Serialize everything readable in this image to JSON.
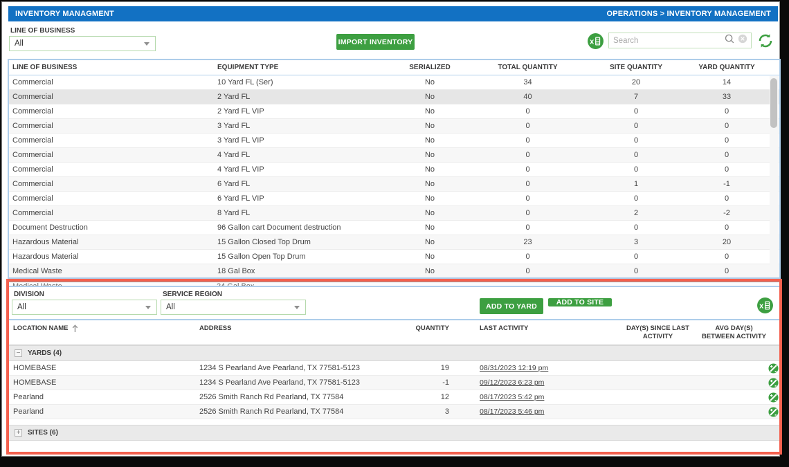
{
  "header": {
    "title": "INVENTORY MANAGMENT",
    "breadcrumb": "OPERATIONS > INVENTORY MANAGEMENT"
  },
  "toolbar": {
    "line_of_business_label": "LINE OF BUSINESS",
    "line_of_business_value": "All",
    "import_button": "IMPORT INVENTORY",
    "search_placeholder": "Search"
  },
  "inventory_table": {
    "columns": [
      "LINE OF BUSINESS",
      "EQUIPMENT TYPE",
      "SERIALIZED",
      "TOTAL QUANTITY",
      "SITE QUANTITY",
      "YARD QUANTITY"
    ],
    "selected_row_index": 1,
    "rows": [
      [
        "Commercial",
        "10 Yard FL (Ser)",
        "No",
        "34",
        "20",
        "14"
      ],
      [
        "Commercial",
        "2 Yard FL",
        "No",
        "40",
        "7",
        "33"
      ],
      [
        "Commercial",
        "2 Yard FL VIP",
        "No",
        "0",
        "0",
        "0"
      ],
      [
        "Commercial",
        "3 Yard FL",
        "No",
        "0",
        "0",
        "0"
      ],
      [
        "Commercial",
        "3 Yard FL VIP",
        "No",
        "0",
        "0",
        "0"
      ],
      [
        "Commercial",
        "4 Yard FL",
        "No",
        "0",
        "0",
        "0"
      ],
      [
        "Commercial",
        "4 Yard FL VIP",
        "No",
        "0",
        "0",
        "0"
      ],
      [
        "Commercial",
        "6 Yard FL",
        "No",
        "0",
        "1",
        "-1"
      ],
      [
        "Commercial",
        "6 Yard FL VIP",
        "No",
        "0",
        "0",
        "0"
      ],
      [
        "Commercial",
        "8 Yard FL",
        "No",
        "0",
        "2",
        "-2"
      ],
      [
        "Document Destruction",
        "96 Gallon cart Document destruction",
        "No",
        "0",
        "0",
        "0"
      ],
      [
        "Hazardous Material",
        "15 Gallon Closed Top Drum",
        "No",
        "23",
        "3",
        "20"
      ],
      [
        "Hazardous Material",
        "15 Gallon Open Top Drum",
        "No",
        "0",
        "0",
        "0"
      ],
      [
        "Medical Waste",
        "18 Gal Box",
        "No",
        "0",
        "0",
        "0"
      ]
    ],
    "clipped_next_row": [
      "Medical Waste",
      "24 Gal Box"
    ]
  },
  "detail_panel": {
    "division_label": "DIVISION",
    "division_value": "All",
    "service_region_label": "SERVICE REGION",
    "service_region_value": "All",
    "add_to_yard_button": "ADD TO YARD",
    "add_to_site_button": "ADD TO SITE",
    "columns": {
      "location": "LOCATION NAME",
      "address": "ADDRESS",
      "quantity": "QUANTITY",
      "last_activity": "LAST ACTIVITY",
      "days_since_line1": "DAY(S) SINCE LAST",
      "days_since_line2": "ACTIVITY",
      "avg_days_line1": "AVG DAY(S)",
      "avg_days_line2": "BETWEEN ACTIVITY"
    },
    "groups": [
      {
        "label": "YARDS (4)",
        "expanded": true,
        "rows": [
          {
            "location": "HOMEBASE",
            "address": "1234 S Pearland Ave Pearland, TX 77581-5123",
            "quantity": "19",
            "last_activity": "08/31/2023 12:19 pm"
          },
          {
            "location": "HOMEBASE",
            "address": "1234 S Pearland Ave Pearland, TX 77581-5123",
            "quantity": "-1",
            "last_activity": "09/12/2023 6:23 pm"
          },
          {
            "location": "Pearland",
            "address": "2526 Smith Ranch Rd Pearland, TX 77584",
            "quantity": "12",
            "last_activity": "08/17/2023 5:42 pm"
          },
          {
            "location": "Pearland",
            "address": "2526 Smith Ranch Rd Pearland, TX 77584",
            "quantity": "3",
            "last_activity": "08/17/2023 5:46 pm"
          }
        ]
      },
      {
        "label": "SITES (6)",
        "expanded": false,
        "rows": []
      }
    ]
  },
  "icons": {
    "toolbar_export": "excel-export-icon",
    "search": "search-icon",
    "search_clear": "clear-search-icon",
    "refresh": "refresh-icon",
    "select_caret": "chevron-down-icon",
    "sort": "sort-ascending-icon",
    "group_collapsed": "expand-icon",
    "group_expanded": "collapse-icon",
    "row_action": "adjust-quantity-icon",
    "panel_export": "excel-export-icon"
  },
  "colors": {
    "header_blue": "#1271c3",
    "button_green": "#3d9f41",
    "input_border_green": "#b5d9ac",
    "table_border_blue": "#aecdea",
    "highlight_border_red": "#f4604e",
    "selected_row_gray": "#e6e6e6"
  }
}
